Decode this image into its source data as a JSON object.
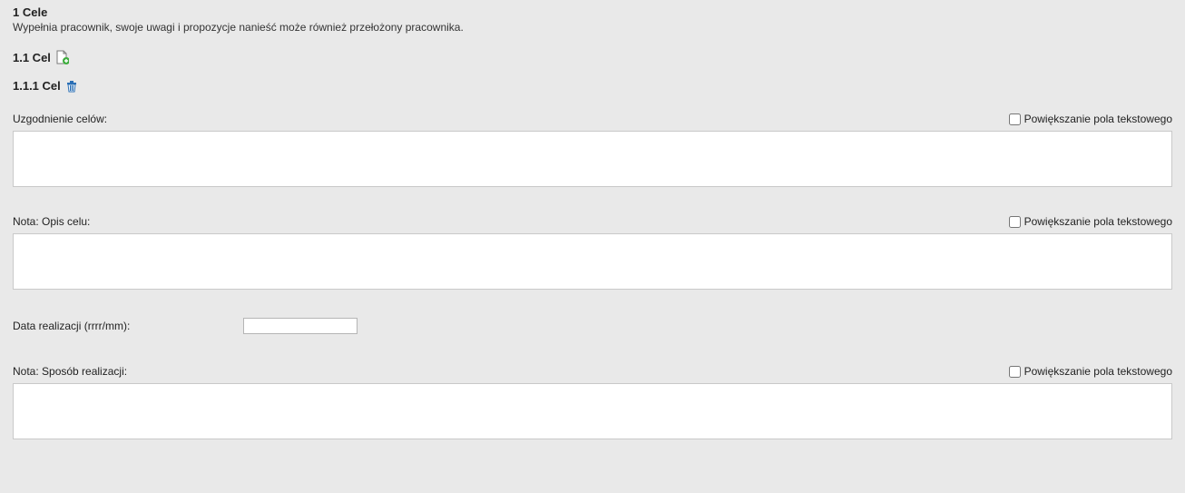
{
  "section": {
    "title": "1 Cele",
    "subtitle": "Wypełnia pracownik, swoje uwagi i propozycje nanieść może również przełożony pracownika."
  },
  "subsection": {
    "title": "1.1 Cel"
  },
  "item": {
    "title": "1.1.1 Cel"
  },
  "fields": {
    "goals_agreement": {
      "label": "Uzgodnienie celów:",
      "expand_label": "Powiększanie pola tekstowego",
      "value": ""
    },
    "goal_note": {
      "label": "Nota: Opis celu:",
      "expand_label": "Powiększanie pola tekstowego",
      "value": ""
    },
    "date": {
      "label": "Data realizacji (rrrr/mm):",
      "value": ""
    },
    "method_note": {
      "label": "Nota: Sposób realizacji:",
      "expand_label": "Powiększanie pola tekstowego",
      "value": ""
    }
  }
}
